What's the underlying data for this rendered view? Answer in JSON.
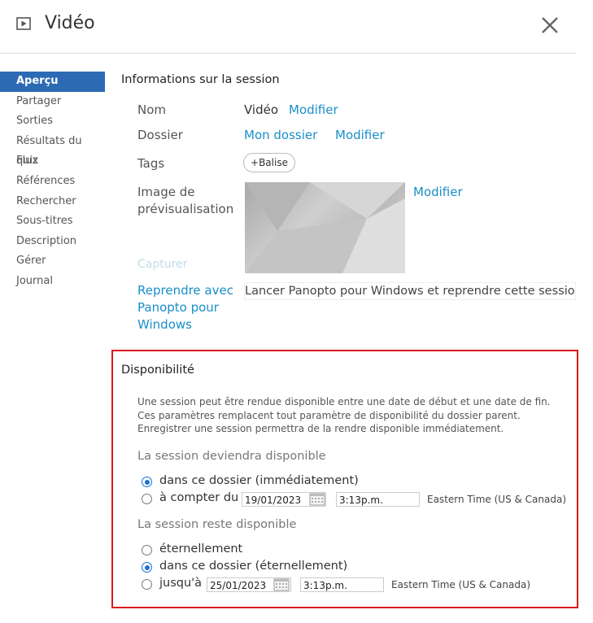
{
  "header": {
    "title": "Vidéo"
  },
  "sidebar": {
    "items": [
      {
        "label": "Aperçu",
        "active": true
      },
      {
        "label": "Partager"
      },
      {
        "label": "Sorties"
      },
      {
        "label": "Résultats du quiz"
      },
      {
        "label": "Flux"
      },
      {
        "label": "Références"
      },
      {
        "label": "Rechercher"
      },
      {
        "label": "Sous-titres"
      },
      {
        "label": "Description"
      },
      {
        "label": "Gérer"
      },
      {
        "label": "Journal"
      }
    ]
  },
  "session": {
    "title": "Informations sur la session",
    "name_label": "Nom",
    "name_value": "Vidéo",
    "name_edit": "Modifier",
    "folder_label": "Dossier",
    "folder_value": "Mon dossier",
    "folder_edit": "Modifier",
    "tags_label": "Tags",
    "tag_button": "Balise",
    "preview_label_1": "Image de",
    "preview_label_2": "prévisualisation",
    "preview_edit": "Modifier",
    "capture": "Capturer",
    "resume_1": "Reprendre avec",
    "resume_2": "Panopto pour",
    "resume_3": "Windows",
    "resume_text": "Lancer Panopto pour Windows et reprendre cette session"
  },
  "availability": {
    "title": "Disponibilité",
    "description": "Une session peut être rendue disponible entre une date de début et une date de fin. Ces paramètres remplacent tout paramètre de disponibilité du dossier parent. Enregistrer une session permettra de la rendre disponible immédiatement.",
    "start_heading": "La session deviendra disponible",
    "start_opt1": "dans ce dossier (immédiatement)",
    "start_opt2": "à compter du",
    "start_date": "19/01/2023",
    "start_time": "3:13p.m.",
    "start_tz": "Eastern Time (US & Canada)",
    "end_heading": "La session reste disponible",
    "end_opt1": "éternellement",
    "end_opt2": "dans ce dossier (éternellement)",
    "end_opt3": "jusqu'à",
    "end_date": "25/01/2023",
    "end_time": "3:13p.m.",
    "end_tz": "Eastern Time (US & Canada)"
  },
  "colors": {
    "accent": "#2d6ab4",
    "link": "#1a8fc9",
    "highlight_border": "#d9191f",
    "radio": "#1a6fd1"
  }
}
